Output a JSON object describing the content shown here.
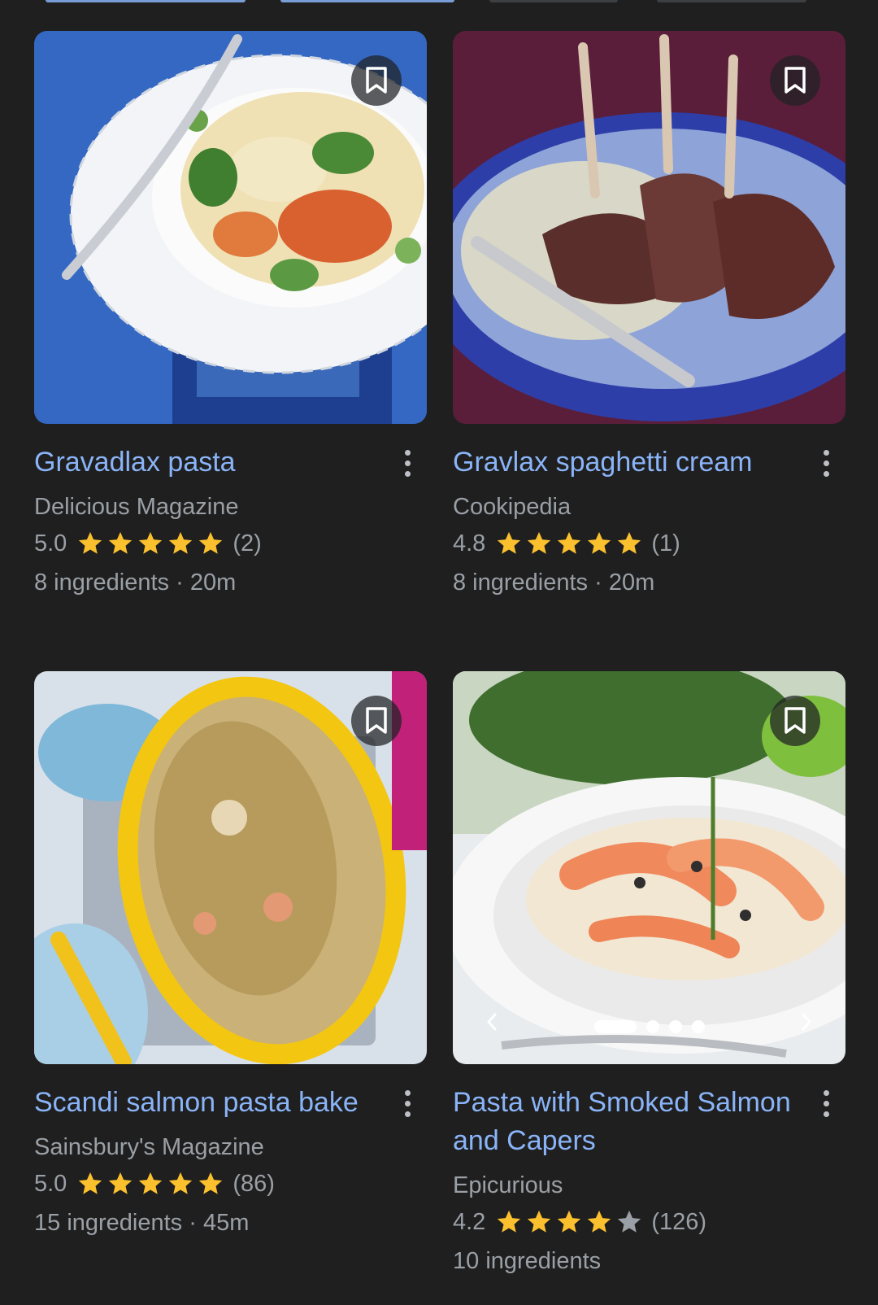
{
  "colors": {
    "background": "#1f1f1f",
    "title": "#8ab4f8",
    "secondary_text": "#9aa0a6",
    "star_filled": "#fbc02d",
    "star_empty": "#9aa0a6"
  },
  "cards": [
    {
      "title": "Gravadlax pasta",
      "source": "Delicious Magazine",
      "rating": "5.0",
      "stars_filled": 5,
      "review_count": "(2)",
      "meta": "8 ingredients · 20m",
      "save_icon": "bookmark-icon",
      "more_icon": "more-vert-icon"
    },
    {
      "title": "Gravlax spaghetti cream",
      "source": "Cookipedia",
      "rating": "4.8",
      "stars_filled": 5,
      "review_count": "(1)",
      "meta": "8 ingredients · 20m",
      "save_icon": "bookmark-icon",
      "more_icon": "more-vert-icon"
    },
    {
      "title": "Scandi salmon pasta bake",
      "source": "Sainsbury's Magazine",
      "rating": "5.0",
      "stars_filled": 5,
      "review_count": "(86)",
      "meta": "15 ingredients · 45m",
      "save_icon": "bookmark-icon",
      "more_icon": "more-vert-icon"
    },
    {
      "title": "Pasta with Smoked Salmon and Capers",
      "source": "Epicurious",
      "rating": "4.2",
      "stars_filled": 4,
      "review_count": "(126)",
      "meta": "10 ingredients",
      "save_icon": "bookmark-icon",
      "more_icon": "more-vert-icon",
      "carousel": {
        "image_count": 4,
        "active_index": 0,
        "prev_icon": "chevron-left-icon",
        "next_icon": "chevron-right-icon"
      }
    }
  ]
}
